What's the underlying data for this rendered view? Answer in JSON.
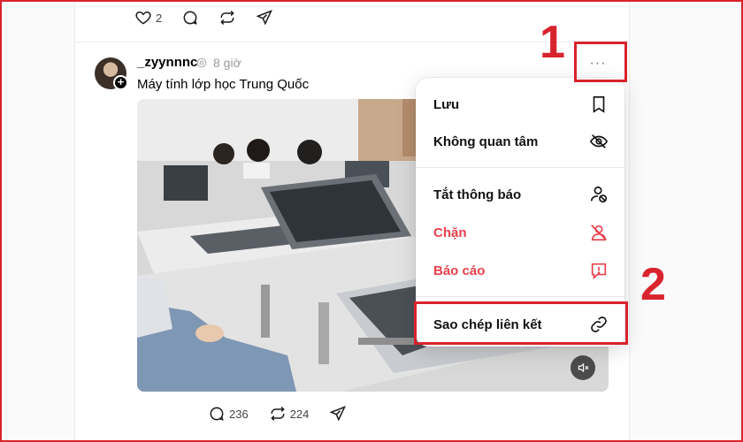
{
  "colors": {
    "annotation_red": "#d9232d",
    "danger_text": "#e8404b"
  },
  "prev_post": {
    "like_count": "2",
    "icons": [
      "heart-icon",
      "comment-icon",
      "repost-icon",
      "share-icon"
    ]
  },
  "post": {
    "username": "_zyynnnc",
    "time": "8 giờ",
    "caption": "Máy tính lớp học Trung Quốc",
    "more_label": "···",
    "reply_count": "236",
    "repost_count": "224"
  },
  "menu": {
    "items": [
      {
        "label": "Lưu",
        "icon": "bookmark-icon"
      },
      {
        "label": "Không quan tâm",
        "icon": "eye-off-icon"
      },
      {
        "label": "Tắt thông báo",
        "icon": "mute-user-icon"
      },
      {
        "label": "Chặn",
        "icon": "block-user-icon"
      },
      {
        "label": "Báo cáo",
        "icon": "report-icon"
      },
      {
        "label": "Sao chép liên kết",
        "icon": "link-icon"
      }
    ]
  },
  "annotations": {
    "step1": "1",
    "step2": "2"
  }
}
